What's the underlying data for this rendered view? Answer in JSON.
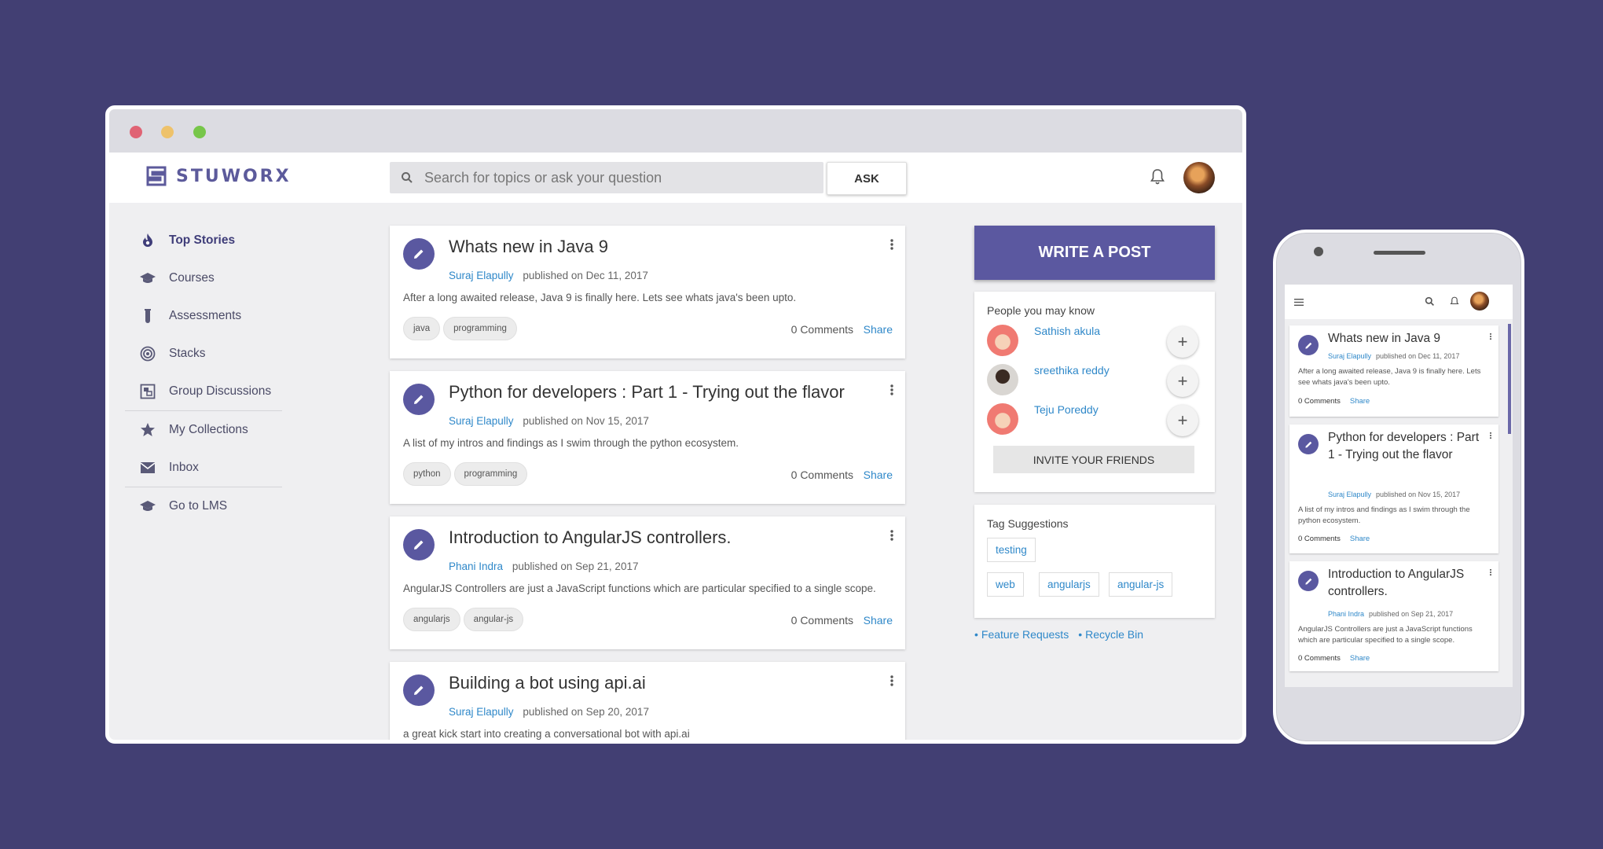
{
  "app": {
    "name": "STUWORX"
  },
  "header": {
    "search_placeholder": "Search for topics or ask your question",
    "ask_label": "ASK"
  },
  "sidebar": {
    "items": [
      {
        "label": "Top Stories",
        "icon": "fire-icon",
        "active": true
      },
      {
        "label": "Courses",
        "icon": "graduation-cap-icon"
      },
      {
        "label": "Assessments",
        "icon": "test-tube-icon"
      },
      {
        "label": "Stacks",
        "icon": "target-icon"
      },
      {
        "label": "Group Discussions",
        "icon": "group-board-icon"
      },
      {
        "label": "My Collections",
        "icon": "star-icon"
      },
      {
        "label": "Inbox",
        "icon": "mail-icon"
      },
      {
        "label": "Go to LMS",
        "icon": "graduation-cap-icon"
      }
    ]
  },
  "posts": [
    {
      "title": "Whats new in Java 9",
      "author": "Suraj Elapully",
      "published": "published on Dec 11, 2017",
      "excerpt": "After a long awaited release, Java 9 is finally here. Lets see whats java's been upto.",
      "tags": [
        "java",
        "programming"
      ],
      "comments": "0 Comments",
      "share": "Share"
    },
    {
      "title": "Python for developers : Part 1 - Trying out the flavor",
      "author": "Suraj Elapully",
      "published": "published on Nov 15, 2017",
      "excerpt": "A list of my intros and findings as I swim through the python ecosystem.",
      "tags": [
        "python",
        "programming"
      ],
      "comments": "0 Comments",
      "share": "Share"
    },
    {
      "title": "Introduction to AngularJS controllers.",
      "author": "Phani Indra",
      "published": "published on Sep 21, 2017",
      "excerpt": "AngularJS Controllers are just a JavaScript functions which are particular specified to a single scope.",
      "tags": [
        "angularjs",
        "angular-js"
      ],
      "comments": "0 Comments",
      "share": "Share"
    },
    {
      "title": "Building a bot using api.ai",
      "author": "Suraj Elapully",
      "published": "published on Sep 20, 2017",
      "excerpt": "a great kick start into creating a conversational bot with api.ai"
    }
  ],
  "right": {
    "write_label": "WRITE A POST",
    "people_heading": "People you may know",
    "people": [
      {
        "name": "Sathish akula"
      },
      {
        "name": "sreethika reddy"
      },
      {
        "name": "Teju Poreddy"
      }
    ],
    "add_label": "+",
    "invite_label": "INVITE YOUR FRIENDS",
    "tag_heading": "Tag Suggestions",
    "tag_suggestions": [
      "testing",
      "web",
      "angularjs",
      "angular-js"
    ],
    "links": [
      "Feature Requests",
      "Recycle Bin"
    ]
  },
  "mobile": {
    "posts": [
      {
        "title": "Whats new in Java 9",
        "author": "Suraj Elapully",
        "published": "published on Dec 11, 2017",
        "excerpt": "After a long awaited release, Java 9 is finally here. Lets see whats java's been upto.",
        "comments": "0 Comments",
        "share": "Share"
      },
      {
        "title": "Python for developers : Part 1 - Trying out the flavor",
        "author": "Suraj Elapully",
        "published": "published on Nov 15, 2017",
        "excerpt": "A list of my intros and findings as I swim through the python ecosystem.",
        "comments": "0 Comments",
        "share": "Share"
      },
      {
        "title": "Introduction to AngularJS controllers.",
        "author": "Phani Indra",
        "published": "published on Sep 21, 2017",
        "excerpt": "AngularJS Controllers are just a JavaScript functions which are particular specified to a single scope.",
        "comments": "0 Comments",
        "share": "Share"
      }
    ]
  },
  "colors": {
    "background": "#423f73",
    "accent": "#5b58a0",
    "link": "#2f88c9"
  }
}
